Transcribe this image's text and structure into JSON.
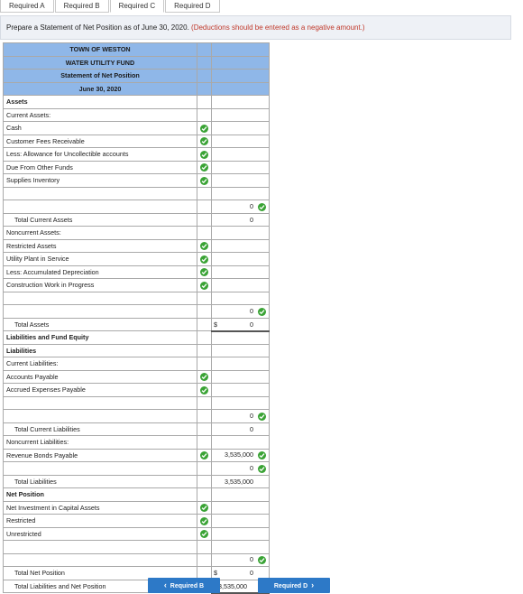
{
  "tabs": [
    "Required A",
    "Required B",
    "Required C",
    "Required D"
  ],
  "instructions": {
    "text": "Prepare a Statement of Net Position as of June 30, 2020.",
    "note": "(Deductions should be entered as a negative amount.)"
  },
  "header": {
    "line1": "TOWN OF WESTON",
    "line2": "WATER UTILITY FUND",
    "line3": "Statement of Net Position",
    "line4": "June 30, 2020"
  },
  "rows": {
    "assets": "Assets",
    "current_assets": "Current Assets:",
    "cash": "Cash",
    "customer_fees": "Customer Fees Receivable",
    "allowance": "Less: Allowance for Uncollectible accounts",
    "due_from": "Due From Other Funds",
    "supplies": "Supplies Inventory",
    "total_current_assets": "Total Current Assets",
    "noncurrent_assets": "Noncurrent Assets:",
    "restricted_assets": "Restricted Assets",
    "utility_plant": "Utility Plant in Service",
    "accum_dep": "Less: Accumulated Depreciation",
    "construction": "Construction Work in Progress",
    "total_assets": "Total Assets",
    "liab_fund_equity": "Liabilities and Fund Equity",
    "liabilities": "Liabilities",
    "current_liabilities": "Current Liabilities:",
    "accounts_payable": "Accounts Payable",
    "accrued_expenses": "Accrued Expenses Payable",
    "total_current_liabilities": "Total Current Liabilities",
    "noncurrent_liabilities": "Noncurrent Liabilities:",
    "revenue_bonds": "Revenue Bonds Payable",
    "total_liabilities": "Total Liabilities",
    "net_position": "Net Position",
    "net_investment": "Net Investment in Capital Assets",
    "restricted": "Restricted",
    "unrestricted": "Unrestricted",
    "total_net_position": "Total Net Position",
    "total_liab_net": "Total Liabilities and Net Position"
  },
  "values": {
    "sub_current_assets": "0",
    "total_current_assets": "0",
    "sub_noncurrent_assets": "0",
    "total_assets": "0",
    "sub_current_liab": "0",
    "total_current_liab": "0",
    "revenue_bonds": "3,535,000",
    "sub_noncurrent_liab": "0",
    "total_liabilities": "3,535,000",
    "sub_net_position": "0",
    "total_net_position": "0",
    "total_liab_net": "$3,535,000"
  },
  "currency": "$",
  "nav": {
    "prev": "Required B",
    "next": "Required D"
  },
  "colors": {
    "header_bg": "#8fb7e8",
    "check": "#3aa335",
    "button": "#2d79c7",
    "note": "#c0392b"
  },
  "icons": [
    "check-circle-icon",
    "chevron-left-icon",
    "chevron-right-icon"
  ]
}
